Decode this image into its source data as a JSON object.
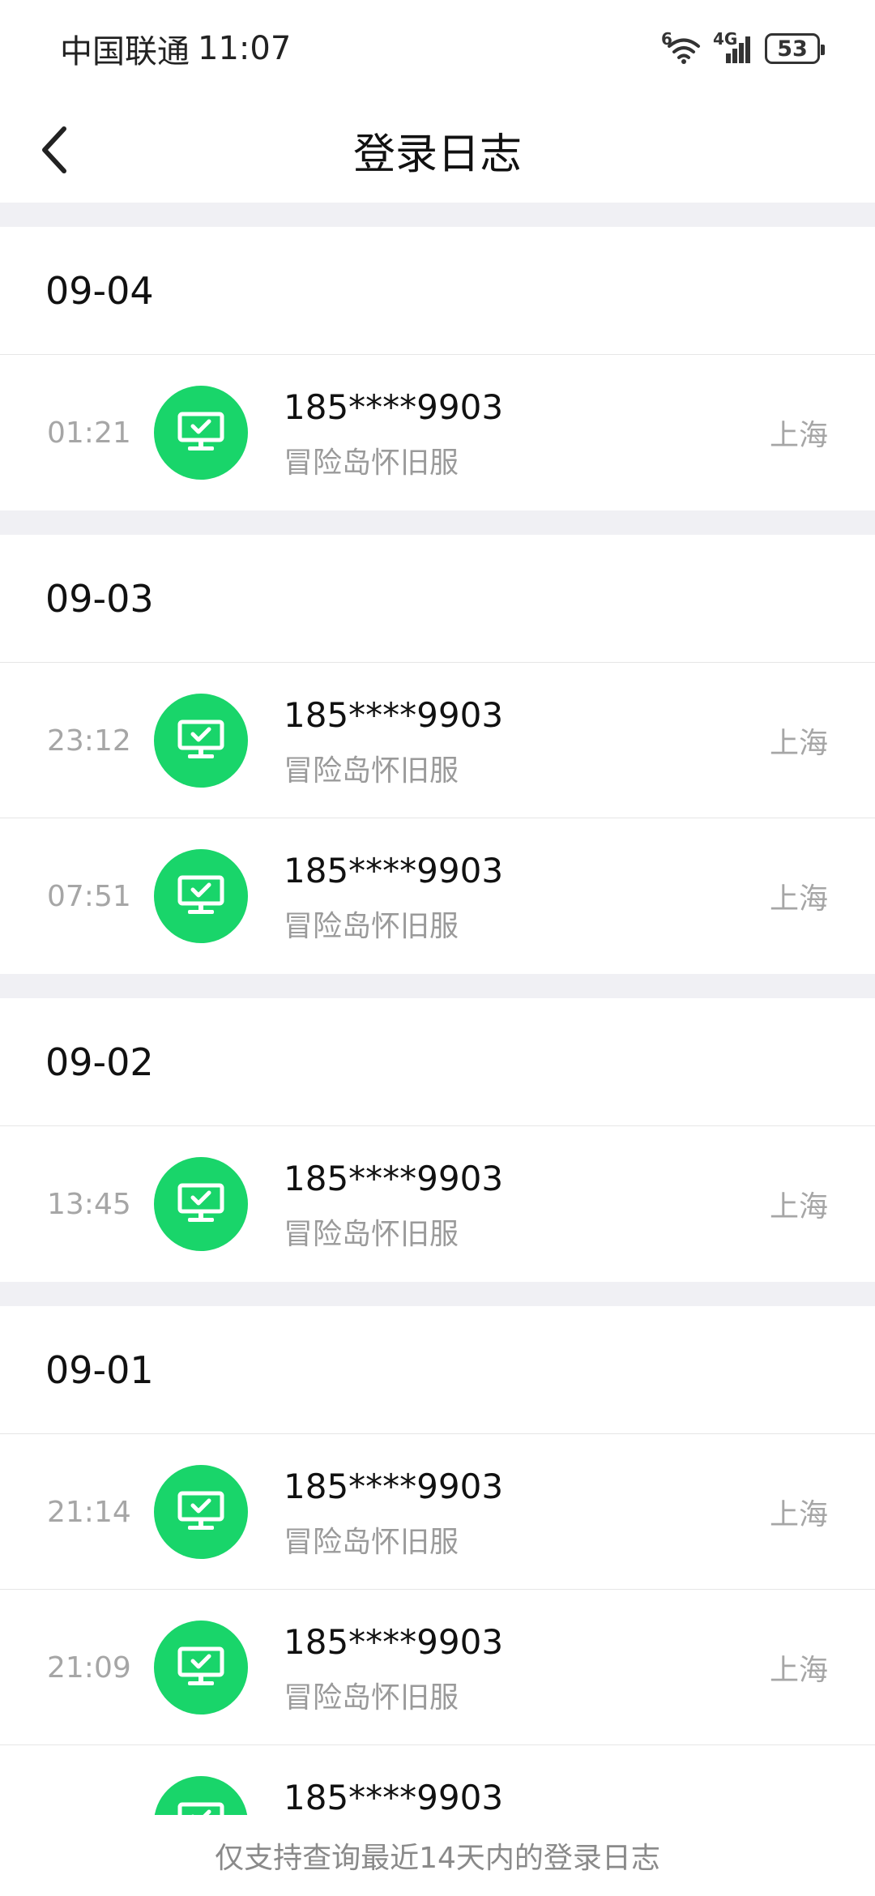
{
  "status_bar": {
    "carrier": "中国联通",
    "time": "11:07",
    "wifi_label": "6",
    "network_label": "4G",
    "battery": "53"
  },
  "header": {
    "title": "登录日志",
    "back_icon": "chevron-left-icon"
  },
  "sections": [
    {
      "date": "09-04",
      "entries": [
        {
          "time": "01:21",
          "account": "185****9903",
          "server": "冒险岛怀旧服",
          "location": "上海"
        }
      ]
    },
    {
      "date": "09-03",
      "entries": [
        {
          "time": "23:12",
          "account": "185****9903",
          "server": "冒险岛怀旧服",
          "location": "上海"
        },
        {
          "time": "07:51",
          "account": "185****9903",
          "server": "冒险岛怀旧服",
          "location": "上海"
        }
      ]
    },
    {
      "date": "09-02",
      "entries": [
        {
          "time": "13:45",
          "account": "185****9903",
          "server": "冒险岛怀旧服",
          "location": "上海"
        }
      ]
    },
    {
      "date": "09-01",
      "entries": [
        {
          "time": "21:14",
          "account": "185****9903",
          "server": "冒险岛怀旧服",
          "location": "上海"
        },
        {
          "time": "21:09",
          "account": "185****9903",
          "server": "冒险岛怀旧服",
          "location": "上海"
        },
        {
          "time": "",
          "account": "185****9903",
          "server": "",
          "location": ""
        }
      ]
    }
  ],
  "colors": {
    "accent_green": "#19d56a",
    "separator": "#f0f0f4"
  },
  "footer": {
    "note": "仅支持查询最近14天内的登录日志"
  }
}
